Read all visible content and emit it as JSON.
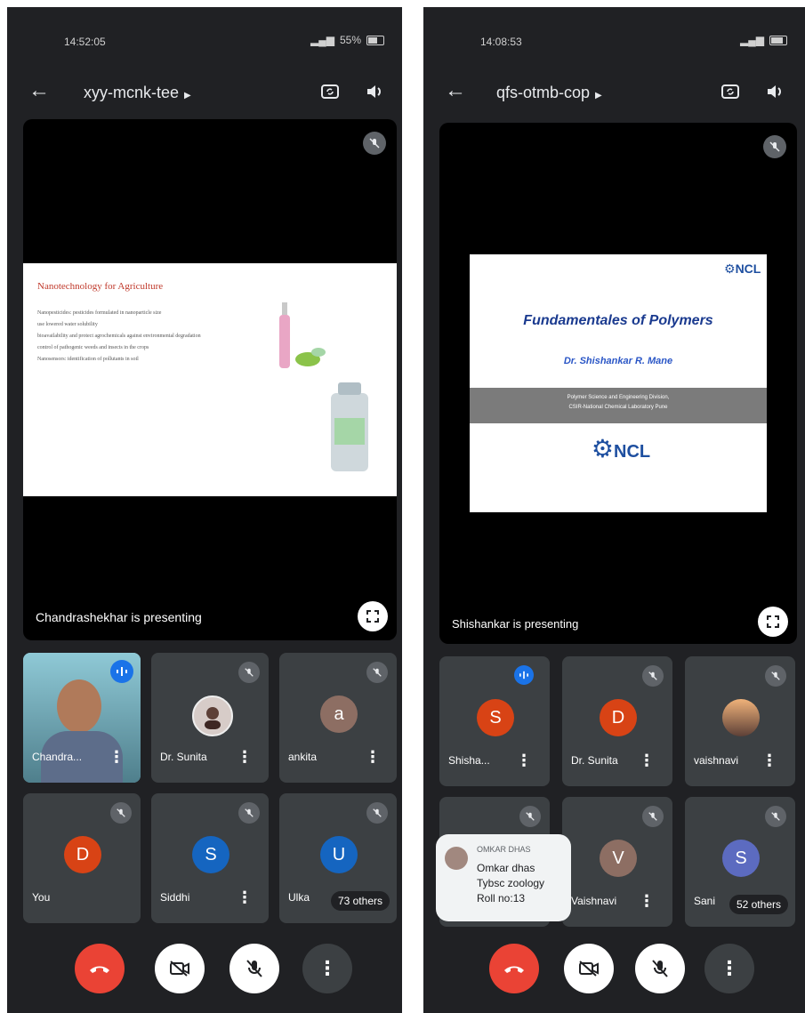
{
  "left": {
    "status_time": "14:52:05",
    "battery": "55%",
    "meeting_code": "xyy-mcnk-tee",
    "presenting": "Chandrashekhar is presenting",
    "slide": {
      "title": "Nanotechnology for Agriculture",
      "bullets": [
        "Nanopesticides: pesticides formulated in nanoparticle size",
        "use lowered water solubility",
        "bioavailability and protect agrochemicals against environmental degradation",
        "control of pathogenic weeds and insects in the crops",
        "Nanosensors: identification of pollutants in soil"
      ]
    },
    "participants": [
      {
        "name": "Chandra...",
        "initial": "",
        "color": "#4a90a4",
        "speaking": true,
        "muted": false
      },
      {
        "name": "Dr. Sunita",
        "initial": "",
        "color": "#8d6e63",
        "speaking": false,
        "muted": true
      },
      {
        "name": "ankita",
        "initial": "a",
        "color": "#8d6e63",
        "speaking": false,
        "muted": true
      },
      {
        "name": "You",
        "initial": "D",
        "color": "#d84315",
        "speaking": false,
        "muted": true
      },
      {
        "name": "Siddhi",
        "initial": "S",
        "color": "#1565c0",
        "speaking": false,
        "muted": true
      },
      {
        "name": "Ulka",
        "initial": "U",
        "color": "#1565c0",
        "speaking": false,
        "muted": true,
        "others": "73 others"
      }
    ]
  },
  "right": {
    "status_time": "14:08:53",
    "meeting_code": "qfs-otmb-cop",
    "presenting": "Shishankar is presenting",
    "slide": {
      "title": "Fundamentales of Polymers",
      "author": "Dr. Shishankar R. Mane",
      "division_line1": "Polymer Science and Engineering Division,",
      "division_line2": "CSIR-National Chemical Laboratory Pune",
      "logo": "NCL"
    },
    "participants": [
      {
        "name": "Shisha...",
        "initial": "S",
        "color": "#d84315",
        "speaking": true,
        "muted": false
      },
      {
        "name": "Dr. Sunita",
        "initial": "D",
        "color": "#d84315",
        "speaking": false,
        "muted": true
      },
      {
        "name": "vaishnavi",
        "initial": "",
        "color": "#c77d4a",
        "speaking": false,
        "muted": true
      },
      {
        "name": "",
        "initial": "",
        "color": "#5f6368",
        "speaking": false,
        "muted": true
      },
      {
        "name": "Vaishnavi",
        "initial": "V",
        "color": "#8d6e63",
        "speaking": false,
        "muted": true
      },
      {
        "name": "Sani",
        "initial": "S",
        "color": "#5c6bc0",
        "speaking": false,
        "muted": true,
        "others": "52 others"
      }
    ],
    "chat": {
      "sender": "OMKAR DHAS",
      "line1": "Omkar dhas",
      "line2": "Tybsc zoology",
      "line3": "Roll no:13"
    }
  }
}
